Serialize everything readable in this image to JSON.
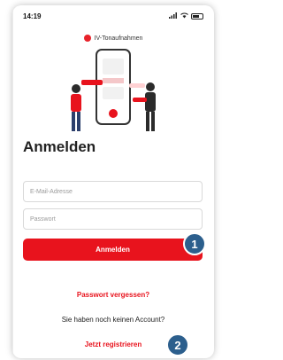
{
  "status_bar": {
    "time": "14:19",
    "signal": "..ıl",
    "wifi": "wifi"
  },
  "brand": {
    "name": "IV-Tonaufnahmen"
  },
  "login": {
    "title": "Anmelden",
    "email_placeholder": "E-Mail-Adresse",
    "password_placeholder": "Passwort",
    "submit_label": "Anmelden",
    "forgot_label": "Passwort vergessen?",
    "no_account_text": "Sie haben noch keinen Account?",
    "register_label": "Jetzt registrieren"
  },
  "annotations": {
    "badge_1": "1",
    "badge_2": "2"
  },
  "colors": {
    "accent": "#e8131d",
    "badge": "#2c5f8d"
  }
}
